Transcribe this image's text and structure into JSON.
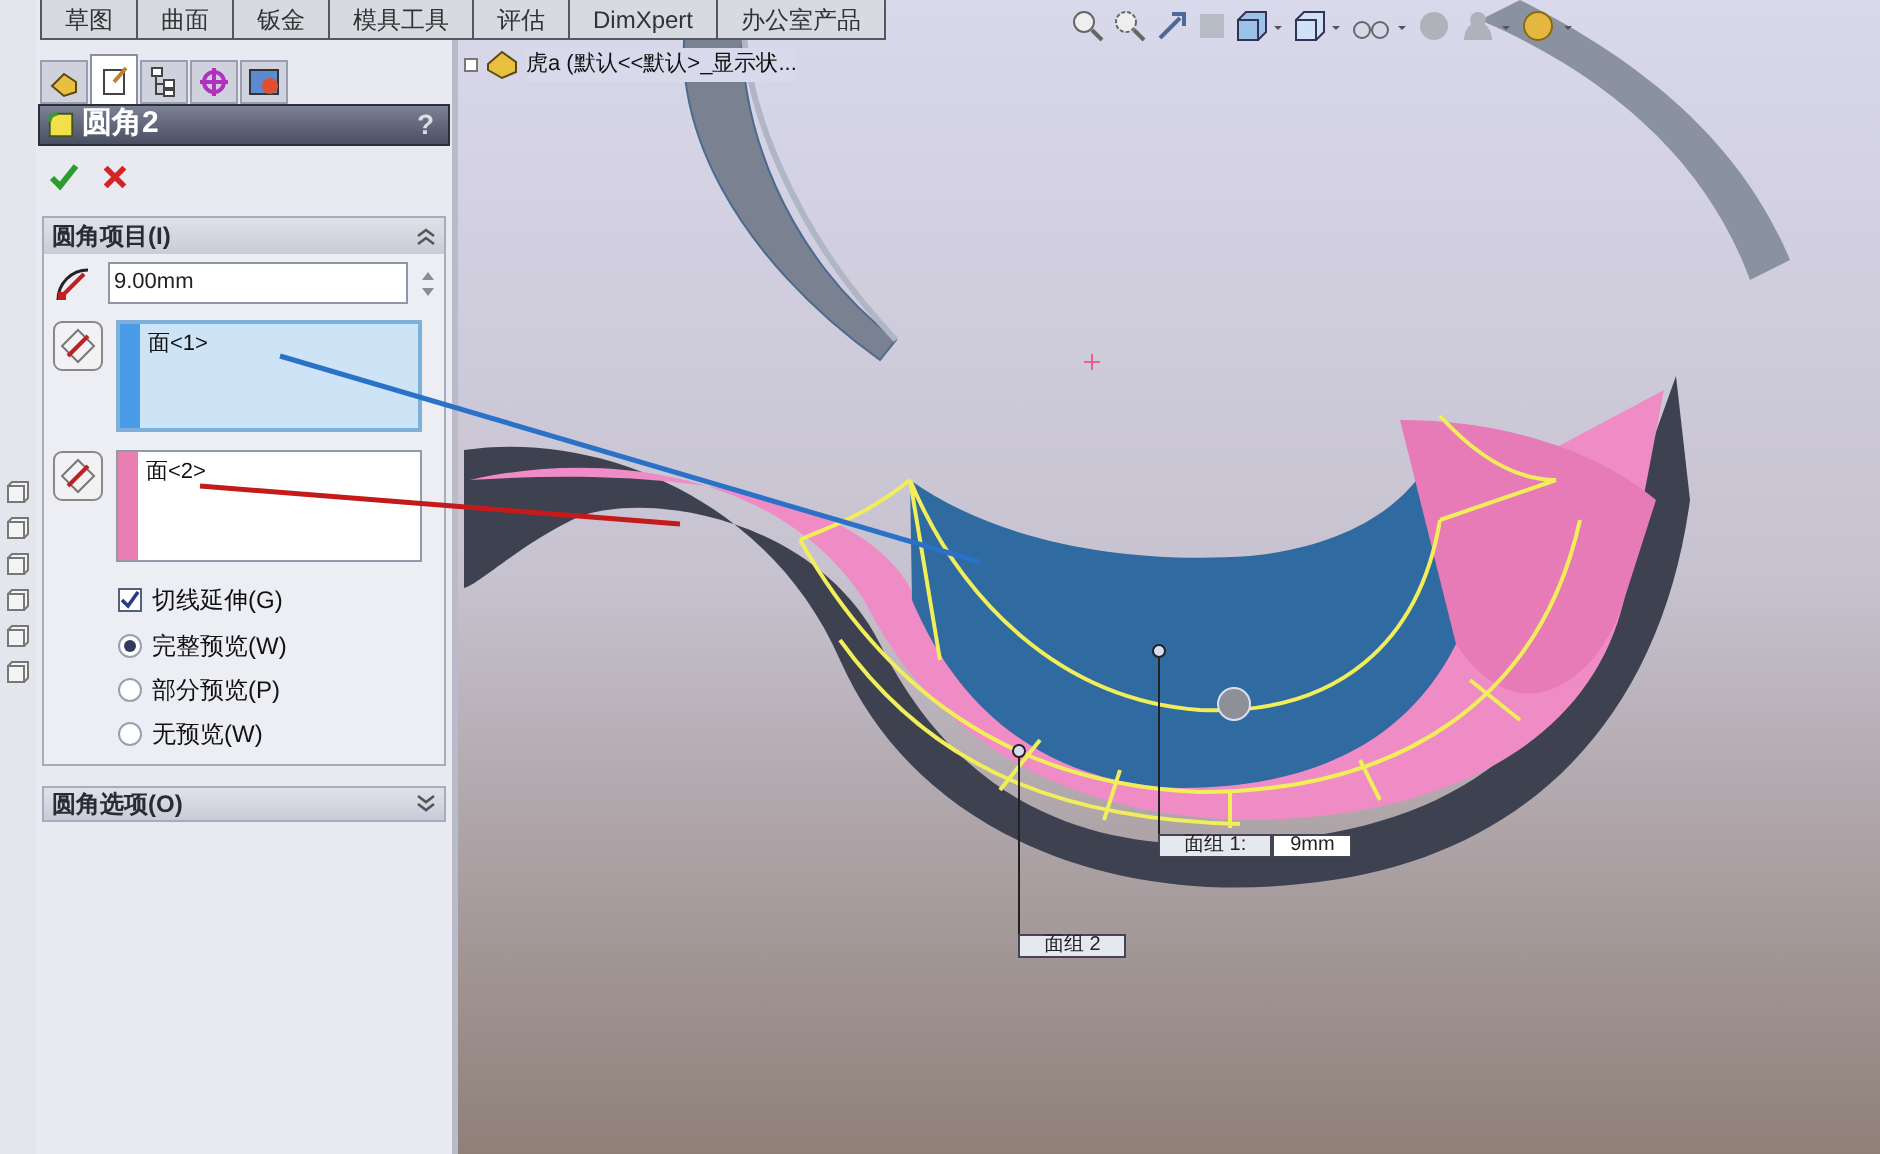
{
  "command_tabs": [
    {
      "label": "草图",
      "selected": false
    },
    {
      "label": "曲面",
      "selected": false
    },
    {
      "label": "钣金",
      "selected": false
    },
    {
      "label": "模具工具",
      "selected": false
    },
    {
      "label": "评估",
      "selected": false
    },
    {
      "label": "DimXpert",
      "selected": false
    },
    {
      "label": "办公室产品",
      "selected": false
    }
  ],
  "panel_tabs": [
    {
      "selected": false
    },
    {
      "selected": true
    },
    {
      "selected": false
    },
    {
      "selected": false
    },
    {
      "selected": false
    }
  ],
  "feature": {
    "title": "圆角2",
    "help": "?"
  },
  "sections": [
    {
      "title": "圆角项目(I)",
      "expanded": true
    },
    {
      "title": "圆角选项(O)",
      "expanded": false
    }
  ],
  "radius": {
    "value": "9.00mm"
  },
  "selection_boxes": [
    {
      "items": [
        "面<1>"
      ],
      "color": "#4a9be8",
      "active": true
    },
    {
      "items": [
        "面<2>"
      ],
      "color": "#e87fb0",
      "active": false
    }
  ],
  "tangent_propagation": {
    "label": "切线延伸(G)",
    "checked": true
  },
  "preview_options": [
    {
      "label": "完整预览(W)",
      "selected": true
    },
    {
      "label": "部分预览(P)",
      "selected": false
    },
    {
      "label": "无预览(W)",
      "selected": false
    }
  ],
  "tree": {
    "root": "虎a (默认<<默认>_显示状..."
  },
  "callouts": [
    {
      "label": "面组 1:",
      "value": "9mm"
    },
    {
      "label": "面组 2"
    }
  ]
}
